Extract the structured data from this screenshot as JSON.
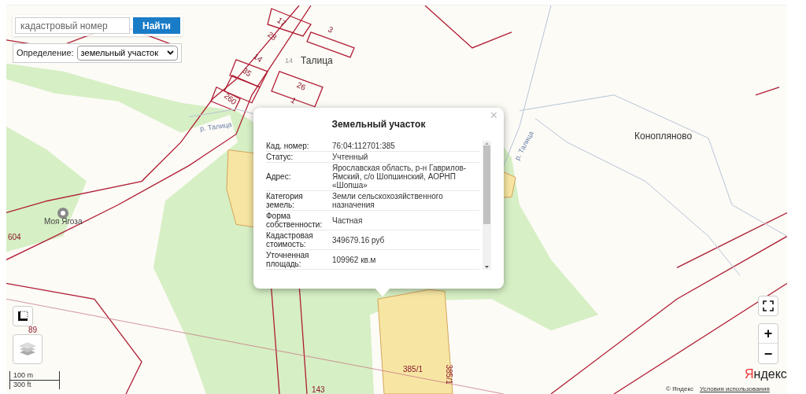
{
  "search": {
    "placeholder": "кадастровый номер",
    "button": "Найти"
  },
  "definition": {
    "label": "Определение:",
    "value": "земельный участок"
  },
  "map_labels": [
    {
      "kind": "place",
      "text": "Талица"
    },
    {
      "kind": "place",
      "text": "Конопляново"
    },
    {
      "kind": "poi",
      "text": "Моя Ягоза"
    },
    {
      "kind": "river",
      "text": "р. Талица"
    },
    {
      "kind": "river",
      "text": "р. Талица"
    },
    {
      "kind": "parcel",
      "text": "17"
    },
    {
      "kind": "parcel",
      "text": "28"
    },
    {
      "kind": "parcel",
      "text": "3"
    },
    {
      "kind": "parcel",
      "text": "14"
    },
    {
      "kind": "house",
      "text": "14"
    },
    {
      "kind": "parcel",
      "text": "35"
    },
    {
      "kind": "parcel",
      "text": "26"
    },
    {
      "kind": "parcel",
      "text": "1"
    },
    {
      "kind": "parcel",
      "text": "260"
    },
    {
      "kind": "parcel",
      "text": "604"
    },
    {
      "kind": "parcel",
      "text": "89"
    },
    {
      "kind": "parcel",
      "text": "143"
    },
    {
      "kind": "parcel",
      "text": "385/1"
    },
    {
      "kind": "parcel",
      "text": "385/1"
    }
  ],
  "popup": {
    "title": "Земельный участок",
    "close": "×",
    "rows": [
      {
        "label": "Кад. номер:",
        "value": "76:04:112701:385"
      },
      {
        "label": "Статус:",
        "value": "Учтенный"
      },
      {
        "label": "Адрес:",
        "value": "Ярославская область, р-н Гаврилов-Ямский, с/о Шопшинский, АОРНП «Шопша»"
      },
      {
        "label": "Категория земель:",
        "value": "Земли сельскохозяйственного назначения"
      },
      {
        "label": "Форма собственности:",
        "value": "Частная"
      },
      {
        "label": "Кадастровая стоимость:",
        "value": "349679.16 руб"
      },
      {
        "label": "Уточненная площадь:",
        "value": "109962 кв.м"
      }
    ]
  },
  "zoom": {
    "in": "+",
    "out": "−"
  },
  "scale": {
    "metric": "100 m",
    "imperial": "300 ft"
  },
  "attribution": {
    "logo": "Яндекс",
    "copyright": "© Яндекс",
    "terms": "Условия использования"
  }
}
